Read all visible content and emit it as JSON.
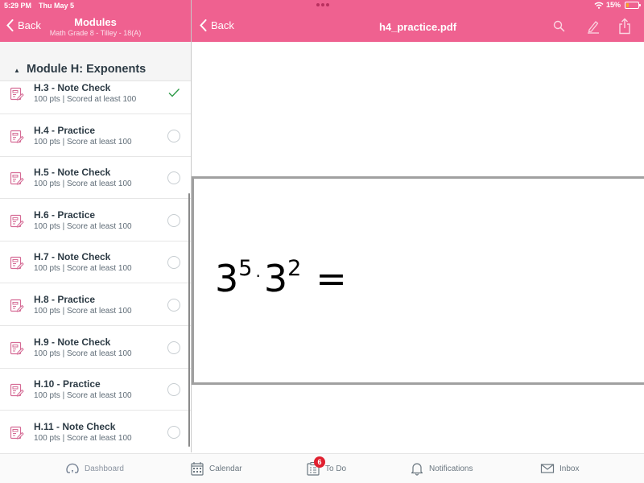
{
  "status_bar": {
    "time": "5:29 PM",
    "date": "Thu May 5",
    "battery": "15%",
    "wifi_icon": "wifi-icon",
    "battery_icon": "battery-low-icon"
  },
  "left_header": {
    "back_label": "Back",
    "title": "Modules",
    "subtitle": "Math Grade 8 - Tilley - 18(A)"
  },
  "right_header": {
    "back_label": "Back",
    "title": "h4_practice.pdf",
    "icons": [
      "search-icon",
      "annotate-pen-icon",
      "share-icon"
    ]
  },
  "module": {
    "name": "Module H: Exponents",
    "items": [
      {
        "title": "H.3 - Note Check",
        "subtitle": "100 pts | Scored at least 100",
        "status": "complete"
      },
      {
        "title": "H.4 - Practice",
        "subtitle": "100 pts | Score at least 100",
        "status": "incomplete"
      },
      {
        "title": "H.5 - Note Check",
        "subtitle": "100 pts | Score at least 100",
        "status": "incomplete"
      },
      {
        "title": "H.6 - Practice",
        "subtitle": "100 pts | Score at least 100",
        "status": "incomplete"
      },
      {
        "title": "H.7 - Note Check",
        "subtitle": "100 pts | Score at least 100",
        "status": "incomplete"
      },
      {
        "title": "H.8 - Practice",
        "subtitle": "100 pts | Score at least 100",
        "status": "incomplete"
      },
      {
        "title": "H.9 - Note Check",
        "subtitle": "100 pts | Score at least 100",
        "status": "incomplete"
      },
      {
        "title": "H.10 - Practice",
        "subtitle": "100 pts | Score at least 100",
        "status": "incomplete"
      },
      {
        "title": "H.11 - Note Check",
        "subtitle": "100 pts | Score at least 100",
        "status": "incomplete"
      }
    ]
  },
  "pdf": {
    "expression": {
      "base1": "3",
      "exp1": "5",
      "operator": "·",
      "base2": "3",
      "exp2": "2",
      "equals": "="
    }
  },
  "tabbar": {
    "tabs": [
      {
        "label": "Dashboard",
        "icon": "dashboard-gauge-icon"
      },
      {
        "label": "Calendar",
        "icon": "calendar-icon"
      },
      {
        "label": "To Do",
        "icon": "todo-clipboard-icon",
        "badge": "6"
      },
      {
        "label": "Notifications",
        "icon": "bell-icon"
      },
      {
        "label": "Inbox",
        "icon": "envelope-icon"
      }
    ]
  },
  "colors": {
    "brand_pink": "#ef6190",
    "complete_green": "#2e9b48",
    "badge_red": "#e0202f",
    "text_dark": "#2d3b45"
  }
}
